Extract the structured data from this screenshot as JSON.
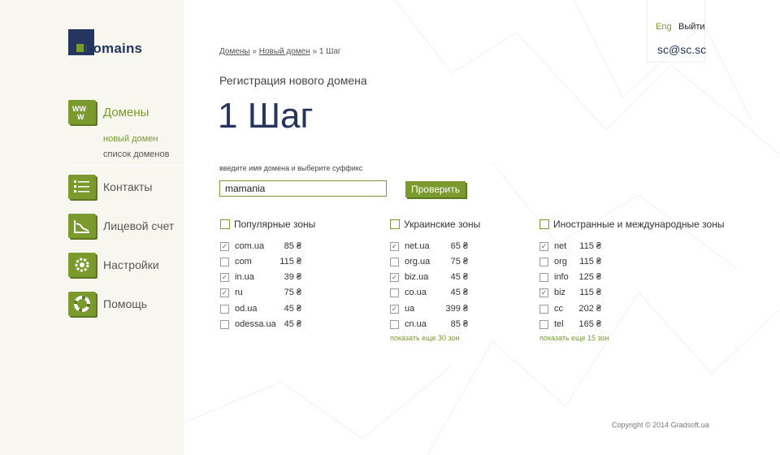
{
  "header": {
    "lang_label": "Eng",
    "logout_label": "Выйти",
    "user_email": "sc@sc.sc"
  },
  "logo": {
    "text": "Domains"
  },
  "sidebar": {
    "items": [
      {
        "label": "Домены",
        "icon": "www-icon",
        "active": true
      },
      {
        "label": "Контакты",
        "icon": "contacts-list-icon"
      },
      {
        "label": "Лицевой счет",
        "icon": "account-chart-icon"
      },
      {
        "label": "Настройки",
        "icon": "gear-icon"
      },
      {
        "label": "Помощь",
        "icon": "lifebuoy-icon"
      }
    ],
    "subitems": [
      {
        "label": "новый домен",
        "active": true
      },
      {
        "label": "список доменов"
      }
    ]
  },
  "breadcrumb": {
    "items": [
      "Домены",
      "Новый домен",
      "1 Шаг"
    ],
    "separator": "»"
  },
  "page": {
    "subtitle": "Регистрация нового домена",
    "step": "1 Шаг",
    "hint": "введите имя домена и выберите суффикс",
    "domain_value": "mamania",
    "check_label": "Проверить"
  },
  "zones": [
    {
      "title": "Популярные зоны",
      "checked": false,
      "rows": [
        {
          "name": "com.ua",
          "price": "85 ₴",
          "checked": true
        },
        {
          "name": "com",
          "price": "115 ₴",
          "checked": false
        },
        {
          "name": "in.ua",
          "price": "39 ₴",
          "checked": true
        },
        {
          "name": "ru",
          "price": "75 ₴",
          "checked": true
        },
        {
          "name": "od.ua",
          "price": "45 ₴",
          "checked": false
        },
        {
          "name": "odessa.ua",
          "price": "45 ₴",
          "checked": false
        }
      ],
      "more": ""
    },
    {
      "title": "Украинские зоны",
      "checked": false,
      "rows": [
        {
          "name": "net.ua",
          "price": "65 ₴",
          "checked": true
        },
        {
          "name": "org.ua",
          "price": "75 ₴",
          "checked": false
        },
        {
          "name": "biz.ua",
          "price": "45 ₴",
          "checked": true
        },
        {
          "name": "co.ua",
          "price": "45 ₴",
          "checked": false
        },
        {
          "name": "ua",
          "price": "399 ₴",
          "checked": true
        },
        {
          "name": "cn.ua",
          "price": "85 ₴",
          "checked": false
        }
      ],
      "more": "показать еще 30 зон"
    },
    {
      "title": "Иностранные и международные зоны",
      "checked": false,
      "rows": [
        {
          "name": "net",
          "price": "115 ₴",
          "checked": true
        },
        {
          "name": "org",
          "price": "115 ₴",
          "checked": false
        },
        {
          "name": "info",
          "price": "125 ₴",
          "checked": false
        },
        {
          "name": "biz",
          "price": "115 ₴",
          "checked": true
        },
        {
          "name": "cc",
          "price": "202 ₴",
          "checked": false
        },
        {
          "name": "tel",
          "price": "165 ₴",
          "checked": false
        }
      ],
      "more": "показать еще 15 зон"
    }
  ],
  "footer": {
    "copyright": "Copyright ©  2014 Gradsoft.ua"
  },
  "colors": {
    "accent": "#7a9a2e",
    "brand": "#24355e",
    "sidebar_bg": "#f7f6ef"
  }
}
